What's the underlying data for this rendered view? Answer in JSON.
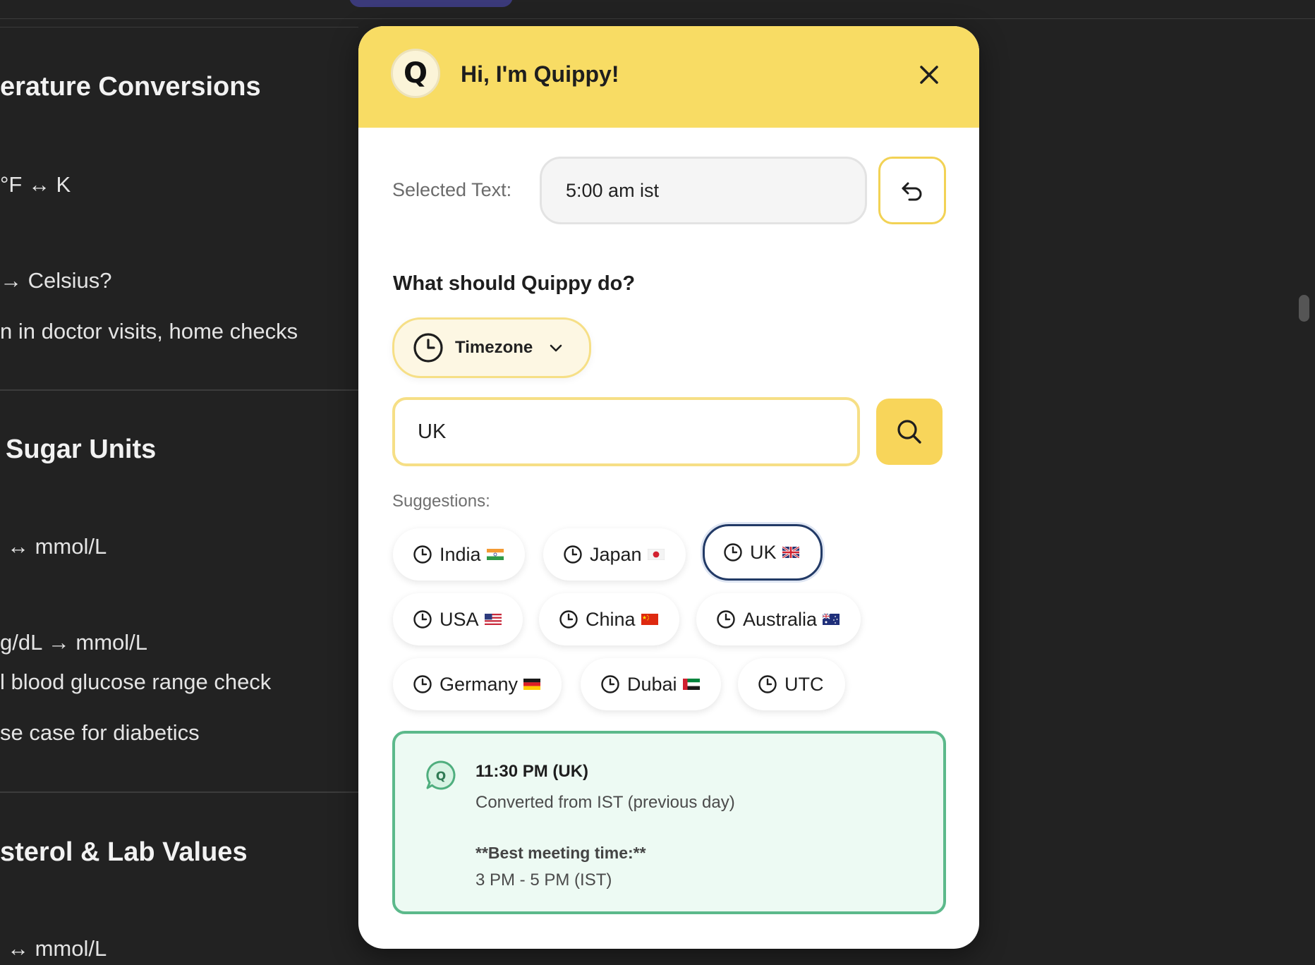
{
  "background": {
    "headings": [
      "erature Conversions",
      "Sugar Units",
      "sterol & Lab Values"
    ],
    "lines": [
      "°F ↔ K",
      "→ Celsius?",
      "n in doctor visits, home checks",
      "↔ mmol/L",
      "g/dL → mmol/L",
      "l blood glucose range check",
      "se case for diabetics",
      "↔ mmol/L"
    ]
  },
  "popup": {
    "logo_letter": "Q",
    "title": "Hi, I'm Quippy!",
    "selected_label": "Selected Text:",
    "selected_value": "5:00 am ist",
    "question": "What should Quippy do?",
    "action_dropdown": "Timezone",
    "search_value": "UK",
    "suggestions_label": "Suggestions:",
    "suggestions": [
      {
        "label": "India",
        "flag": "india-flag-icon"
      },
      {
        "label": "Japan",
        "flag": "japan-flag-icon"
      },
      {
        "label": "UK",
        "flag": "uk-flag-icon",
        "selected": true
      },
      {
        "label": "USA",
        "flag": "usa-flag-icon"
      },
      {
        "label": "China",
        "flag": "china-flag-icon"
      },
      {
        "label": "Australia",
        "flag": "australia-flag-icon"
      },
      {
        "label": "Germany",
        "flag": "germany-flag-icon"
      },
      {
        "label": "Dubai",
        "flag": "uae-flag-icon"
      },
      {
        "label": "UTC",
        "flag": ""
      }
    ],
    "result": {
      "main": "11:30 PM (UK)",
      "sub": "Converted from IST (previous day)",
      "best_label": "**Best meeting time:**",
      "best_value": "3 PM - 5 PM (IST)"
    }
  },
  "colors": {
    "header": "#f8dc64",
    "accent": "#f8d55a",
    "result_border": "#5cb98b",
    "result_bg": "#edfaf3",
    "active_chip_border": "#223a66"
  }
}
